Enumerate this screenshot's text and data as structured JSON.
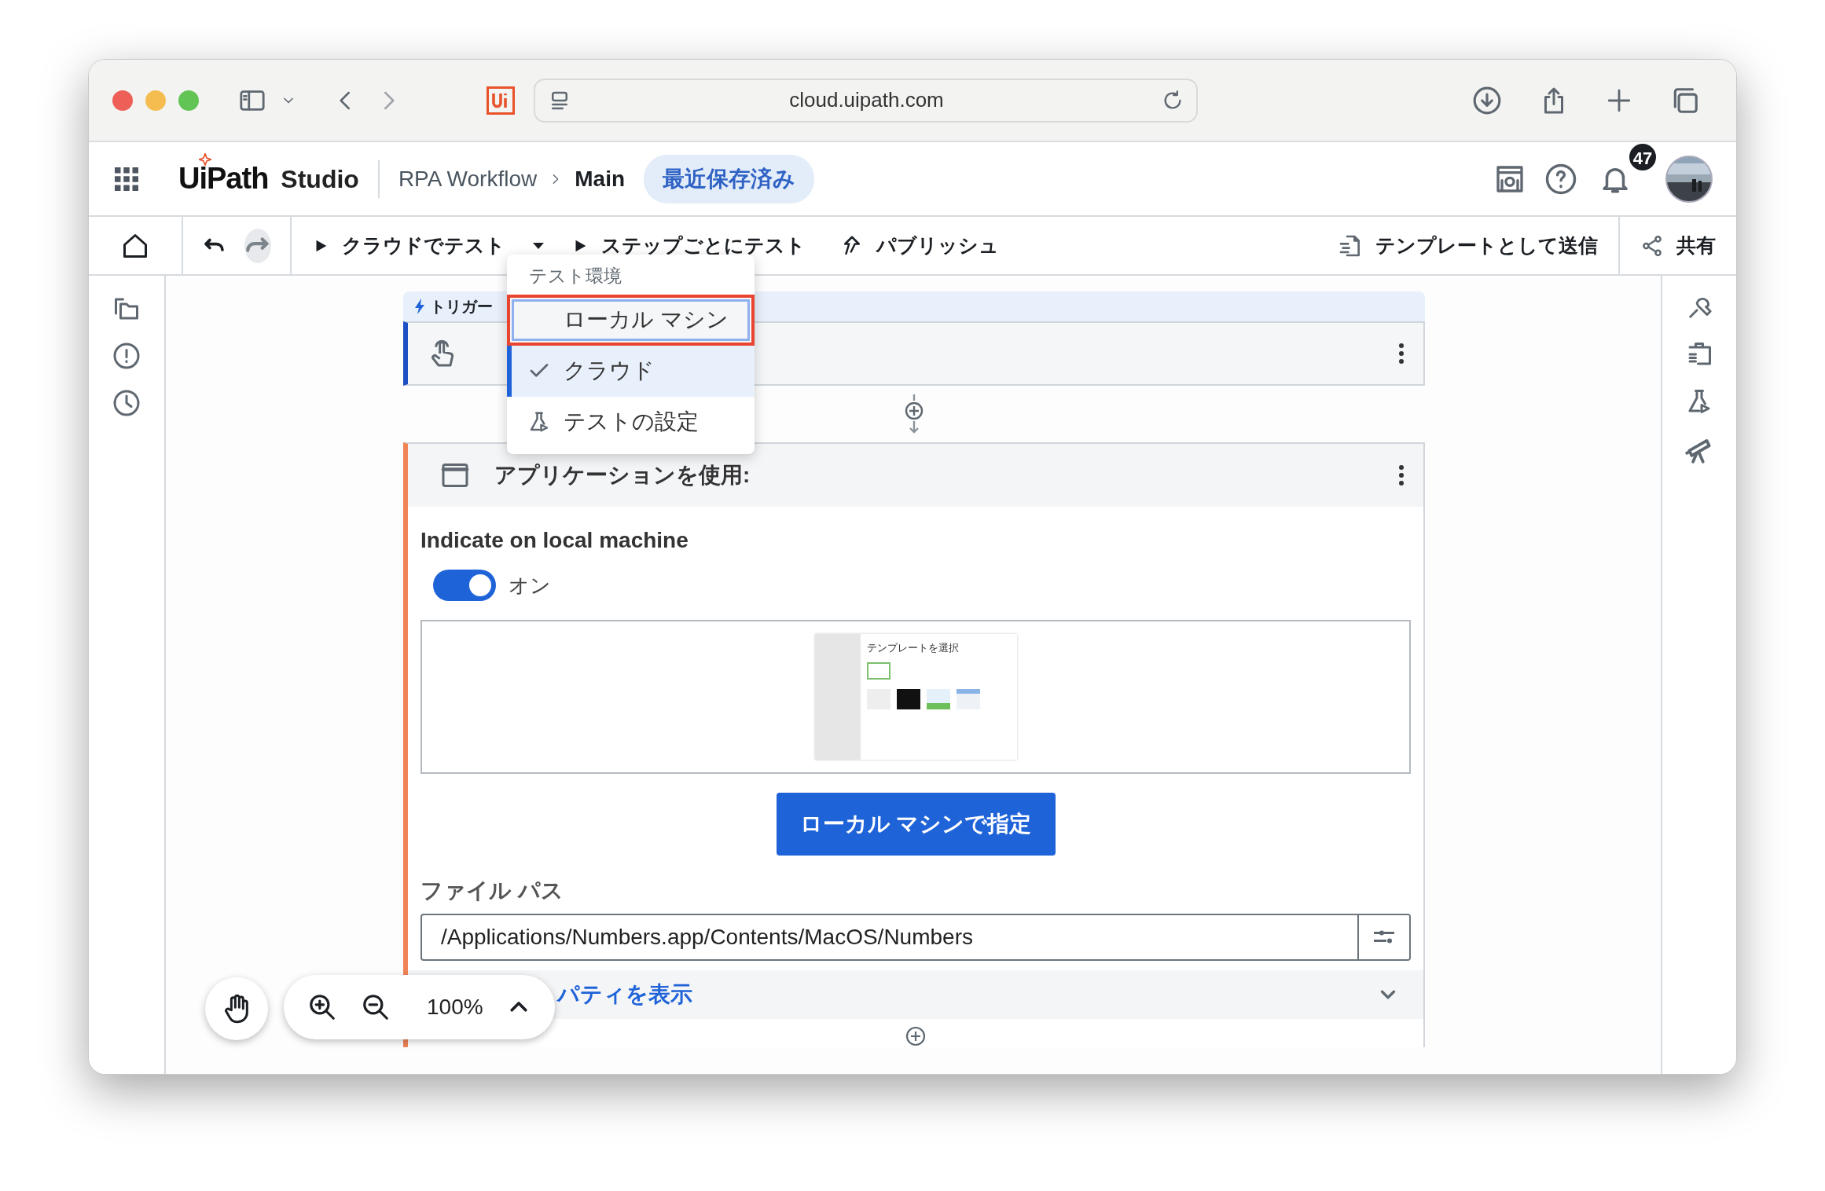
{
  "browser": {
    "url": "cloud.uipath.com"
  },
  "header": {
    "logo": "UiPath",
    "product": "Studio",
    "breadcrumb": [
      "RPA Workflow",
      "Main"
    ],
    "status": "最近保存済み",
    "notifications": "47"
  },
  "toolbar": {
    "actions": [
      {
        "label": "クラウドでテスト",
        "kind": "play-dropdown"
      },
      {
        "label": "ステップごとにテスト",
        "kind": "play"
      },
      {
        "label": "パブリッシュ",
        "kind": "publish"
      }
    ],
    "right": [
      {
        "label": "テンプレートとして送信",
        "kind": "template"
      },
      {
        "label": "共有",
        "kind": "share"
      }
    ]
  },
  "test_menu": {
    "heading": "テスト環境",
    "items": [
      {
        "label": "ローカル マシン",
        "kind": "option",
        "selected": false,
        "focused": true
      },
      {
        "label": "クラウド",
        "kind": "option",
        "selected": true,
        "focused": false
      },
      {
        "label": "テストの設定",
        "kind": "settings",
        "selected": false,
        "focused": false
      }
    ]
  },
  "trigger": {
    "label": "トリガー"
  },
  "activity": {
    "title": "アプリケーションを使用:",
    "indicate_label": "Indicate on local machine",
    "toggle": {
      "on": true,
      "label": "オン"
    },
    "thumbnail_title": "テンプレートを選択",
    "indicate_button": "ローカル マシンで指定",
    "file_path_label": "ファイル パス",
    "file_path": "/Applications/Numbers.app/Contents/MacOS/Numbers",
    "properties_link": "パティを表示"
  },
  "zoom": {
    "level_text": "100%"
  }
}
